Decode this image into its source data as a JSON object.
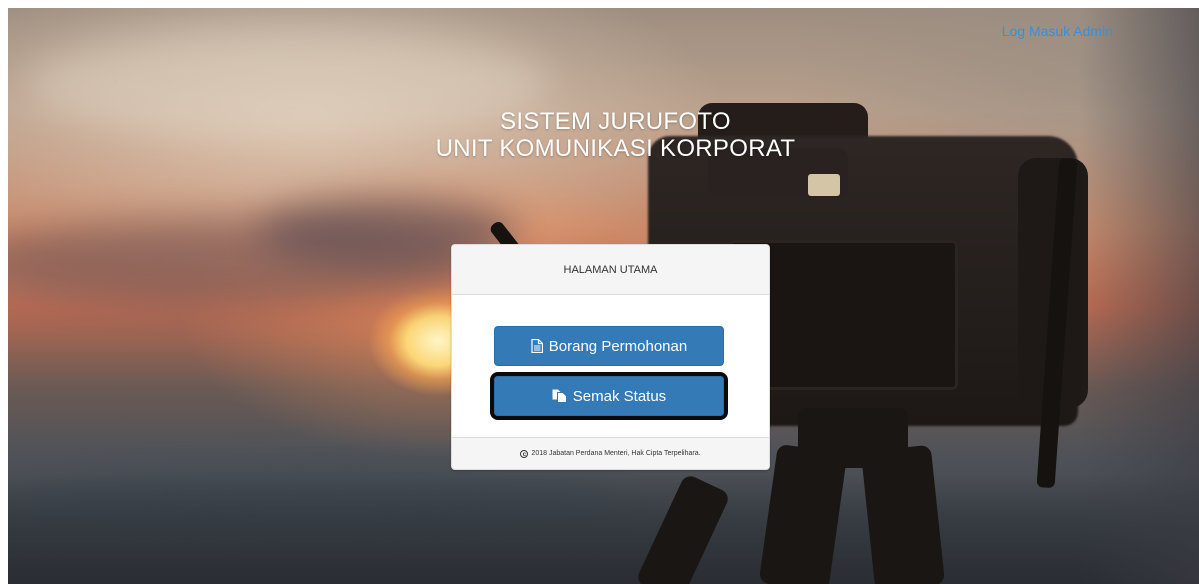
{
  "header": {
    "admin_link": "Log Masuk Admin"
  },
  "hero": {
    "title_line1": "SISTEM JURUFOTO",
    "title_line2": "UNIT KOMUNIKASI KORPORAT"
  },
  "panel": {
    "heading": "HALAMAN UTAMA",
    "buttons": [
      {
        "label": "Borang Permohonan",
        "icon": "file-text-icon"
      },
      {
        "label": "Semak Status",
        "icon": "copy-icon"
      }
    ],
    "footer": {
      "icon": "copyright-icon",
      "text": "2018 Jabatan Perdana Menteri, Hak Cipta Terpelihara."
    }
  },
  "colors": {
    "primary_button": "#337ab7",
    "link": "#3a8fd8",
    "panel_heading_bg": "#f5f5f5"
  }
}
